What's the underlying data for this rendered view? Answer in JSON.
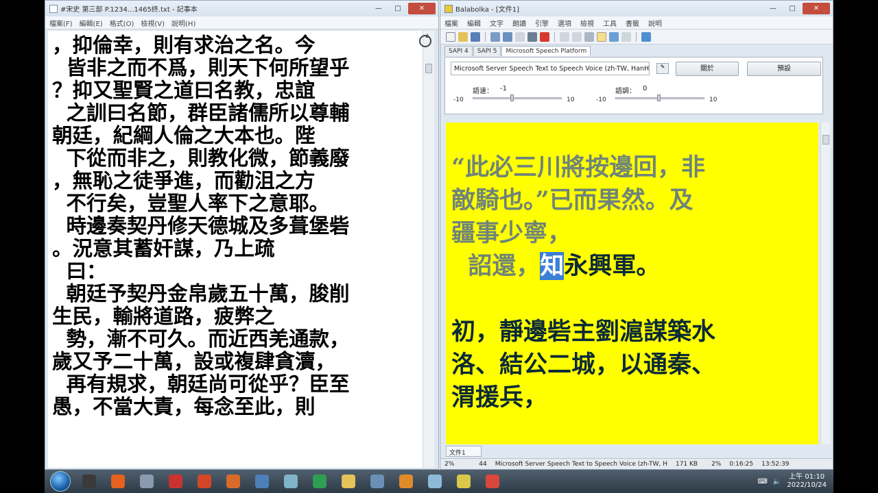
{
  "notepad": {
    "title": "#宋史 第三部 P.1234...1465终.txt - 記事本",
    "menu": [
      "檔案(F)",
      "編輯(E)",
      "格式(O)",
      "檢視(V)",
      "說明(H)"
    ],
    "lines": [
      "，抑倫幸，則有求治之名。今",
      "  皆非之而不爲，則天下何所望乎",
      "？抑又聖賢之道曰名教，忠誼",
      "  之訓曰名節，群臣諸儒所以尊輔",
      "朝廷，紀綱人倫之大本也。陛",
      "  下從而非之，則教化微，節義廢",
      "，無恥之徒爭進，而勸沮之方",
      "  不行矣，豈聖人率下之意耶。",
      "  時邊奏契丹修天德城及多葺堡砦",
      "。況意其蓄奸謀，乃上疏",
      "  曰：",
      "  朝廷予契丹金帛歲五十萬，朘削",
      "生民，輸將道路，疲弊之",
      "  勢，漸不可久。而近西羌通款，",
      "歲又予二十萬，設或複肆貪瀆，",
      "  再有規求，朝廷尚可從乎？臣至",
      "愚，不當大責，每念至此，則"
    ]
  },
  "balabolka": {
    "title": "Balabolka - [文件1]",
    "menu": [
      "檔案",
      "編輯",
      "文字",
      "朗讀",
      "引擎",
      "選項",
      "檢視",
      "工具",
      "書籤",
      "說明"
    ],
    "tabs": [
      "SAPI 4",
      "SAPI 5",
      "Microsoft Speech Platform"
    ],
    "voice": "Microsoft Server Speech Text to Speech Voice (zh-TW, HanHan)",
    "about_button": "關於",
    "default_button": "預設",
    "rate_label": "語速：",
    "rate_value": "-1",
    "pitch_label": "語調：",
    "pitch_value": "0",
    "rate_min": "-10",
    "rate_max": "10",
    "pitch_min": "-10",
    "pitch_max": "10",
    "reader": {
      "read_lines": [
        "“此必三川將按邊回，非",
        "敵騎也。”已而果然。及",
        "疆事少寧，"
      ],
      "current_prefix": "  詔還，",
      "current_word": "知",
      "current_suffix": "永興軍。",
      "unread_lines": [
        "初，靜邊砦主劉滬謀築水",
        "洛、結公二城，以通秦、",
        "渭援兵，"
      ]
    },
    "doc_tab": "文件1",
    "status": {
      "percent_left": "2%",
      "col": "44",
      "voice": "Microsoft Server Speech Text to Speech Voice (zh-TW, H",
      "size": "171 KB",
      "percent_right": "2%",
      "elapsed": "0:16:25",
      "remaining": "13:52:39"
    }
  },
  "taskbar": {
    "time": "上午 01:10",
    "date": "2022/10/24",
    "apps": [
      {
        "icon": "browser-icon",
        "color": "#3a3a3a"
      },
      {
        "icon": "firefox-icon",
        "color": "#e5611d"
      },
      {
        "icon": "network-icon",
        "color": "#8a9bb0"
      },
      {
        "icon": "pdf-icon",
        "color": "#c9332f"
      },
      {
        "icon": "powerpoint-icon",
        "color": "#d24726"
      },
      {
        "icon": "chart-app-icon",
        "color": "#d66b2a"
      },
      {
        "icon": "paint-icon",
        "color": "#4d7fb8"
      },
      {
        "icon": "glass-folder-icon",
        "color": "#7fb4c9"
      },
      {
        "icon": "recycle-icon",
        "color": "#2e9e52"
      },
      {
        "icon": "folder-icon",
        "color": "#e5c25a"
      },
      {
        "icon": "computer-icon",
        "color": "#6b8fb5"
      },
      {
        "icon": "media-player-icon",
        "color": "#e08a2a"
      },
      {
        "icon": "notepad-icon",
        "color": "#8fb9d8"
      },
      {
        "icon": "balabolka-icon",
        "color": "#d9c84a"
      },
      {
        "icon": "chrome-icon",
        "color": "#d9473b"
      }
    ]
  }
}
